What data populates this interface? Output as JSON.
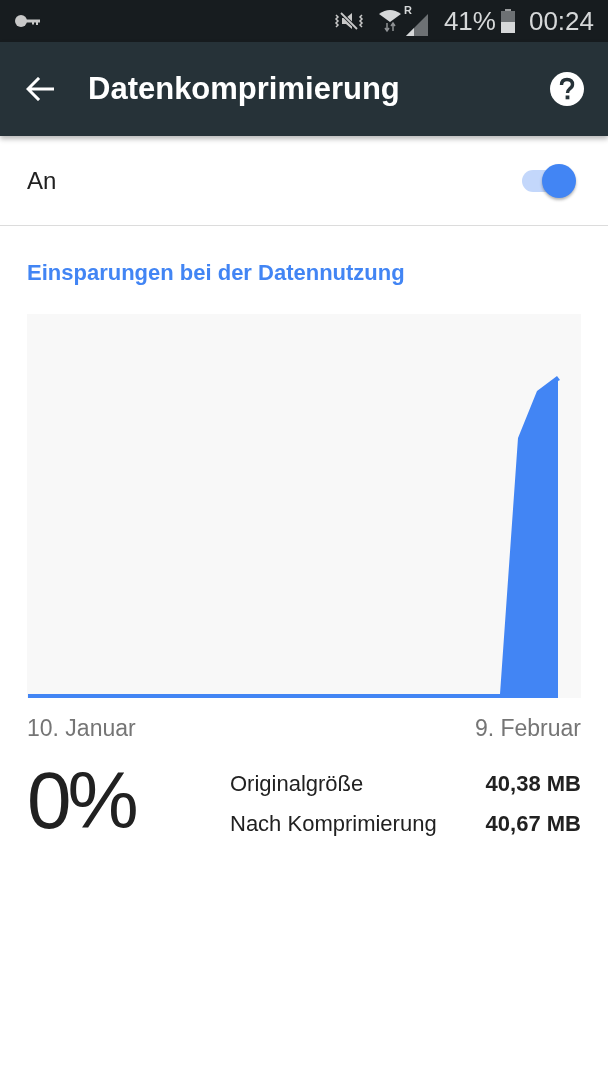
{
  "status_bar": {
    "network_badge": "R",
    "battery_percent": "41%",
    "time": "00:24"
  },
  "app_bar": {
    "title": "Datenkomprimierung"
  },
  "toggle_row": {
    "label": "An",
    "on": true
  },
  "savings": {
    "title": "Einsparungen bei der Datennutzung",
    "chart": {
      "start_label": "10. Januar",
      "end_label": "9. Februar"
    },
    "percent": "0%",
    "stats": [
      {
        "label": "Originalgröße",
        "value": "40,38 MB"
      },
      {
        "label": "Nach Komprimierung",
        "value": "40,67 MB"
      }
    ]
  }
}
